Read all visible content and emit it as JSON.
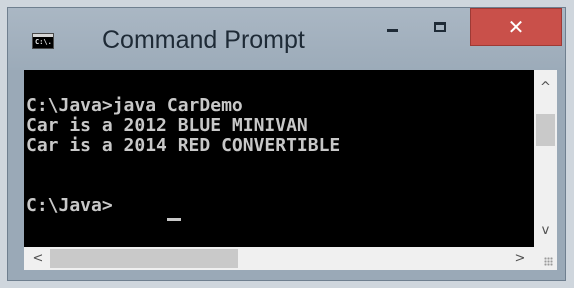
{
  "window": {
    "title": "Command Prompt",
    "icon": "cmd-icon",
    "icon_text": "C:\\.",
    "controls": {
      "minimize": "minimize-icon",
      "maximize": "maximize-icon",
      "close_glyph": "✕"
    }
  },
  "console": {
    "lines": [
      "C:\\Java>java CarDemo",
      "Car is a 2012 BLUE MINIVAN",
      "Car is a 2014 RED CONVERTIBLE",
      "",
      "C:\\Java>"
    ],
    "background": "#000000",
    "text_color": "#c8c8c8"
  },
  "scrollbars": {
    "up_arrow": "^",
    "down_arrow": "v",
    "left_arrow": "<",
    "right_arrow": ">"
  },
  "colors": {
    "titlebar": "#9cabb9",
    "close_button": "#c9504a"
  }
}
